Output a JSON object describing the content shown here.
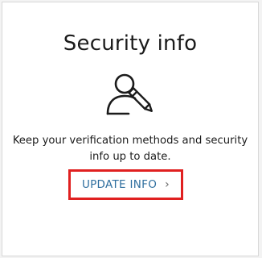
{
  "card": {
    "title": "Security info",
    "icon": "user-edit-icon",
    "description_line1": "Keep your verification methods and security",
    "description_line2": "info up to date.",
    "action_label": "UPDATE INFO",
    "action_chevron": "›"
  },
  "colors": {
    "link": "#2f6f9f",
    "highlight_border": "#e02020"
  }
}
